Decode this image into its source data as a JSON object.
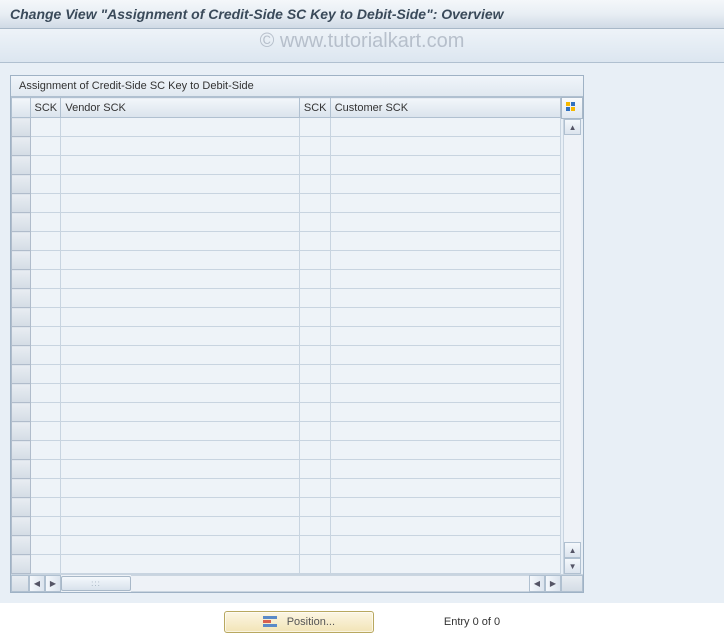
{
  "header": {
    "title": "Change View \"Assignment of Credit-Side SC Key to Debit-Side\": Overview"
  },
  "watermark": "© www.tutorialkart.com",
  "panel": {
    "title": "Assignment of Credit-Side SC Key to Debit-Side"
  },
  "grid": {
    "columns": [
      "SCK",
      "Vendor SCK",
      "SCK",
      "Customer SCK"
    ],
    "row_count": 24,
    "rows": []
  },
  "footer": {
    "position_button": "Position...",
    "entry_text": "Entry 0 of 0"
  },
  "icons": {
    "config": "table-config-icon",
    "up": "▲",
    "down": "▼",
    "left": "◀",
    "right": "▶"
  }
}
